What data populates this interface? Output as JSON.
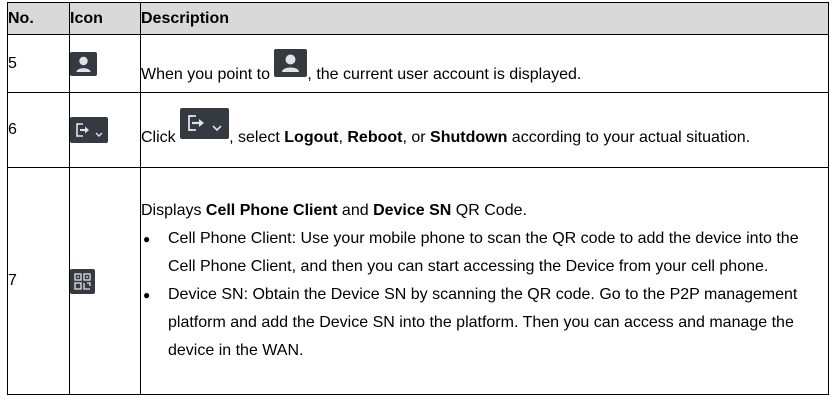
{
  "headers": {
    "no": "No.",
    "icon": "Icon",
    "description": "Description"
  },
  "rows": [
    {
      "no": "5",
      "icon": "user-account-icon",
      "desc_pre": "When you point to",
      "desc_post": ", the current user account is displayed."
    },
    {
      "no": "6",
      "icon": "logout-menu-icon",
      "desc_click": "Click",
      "desc_mid1": ", select ",
      "logout": "Logout",
      "comma1": ", ",
      "reboot": "Reboot",
      "or": ", or ",
      "shutdown": "Shutdown",
      "desc_tail": " according to your actual situation."
    },
    {
      "no": "7",
      "icon": "qr-code-icon",
      "intro_pre": "Displays ",
      "cell_phone_client": "Cell Phone Client",
      "and": " and ",
      "device_sn": "Device SN",
      "intro_post": " QR Code.",
      "bullets": [
        "Cell Phone Client: Use your mobile phone to scan the QR code to add the device into the Cell Phone Client, and then you can start accessing the Device from your cell phone.",
        "Device SN: Obtain the Device SN by scanning the QR code. Go to the P2P management platform and add the Device SN into the platform. Then you can access and manage the device in the WAN."
      ],
      "bullet_glyph": "●"
    }
  ],
  "colors": {
    "icon_bg": "#353a40",
    "header_bg": "#d9d9d9"
  }
}
